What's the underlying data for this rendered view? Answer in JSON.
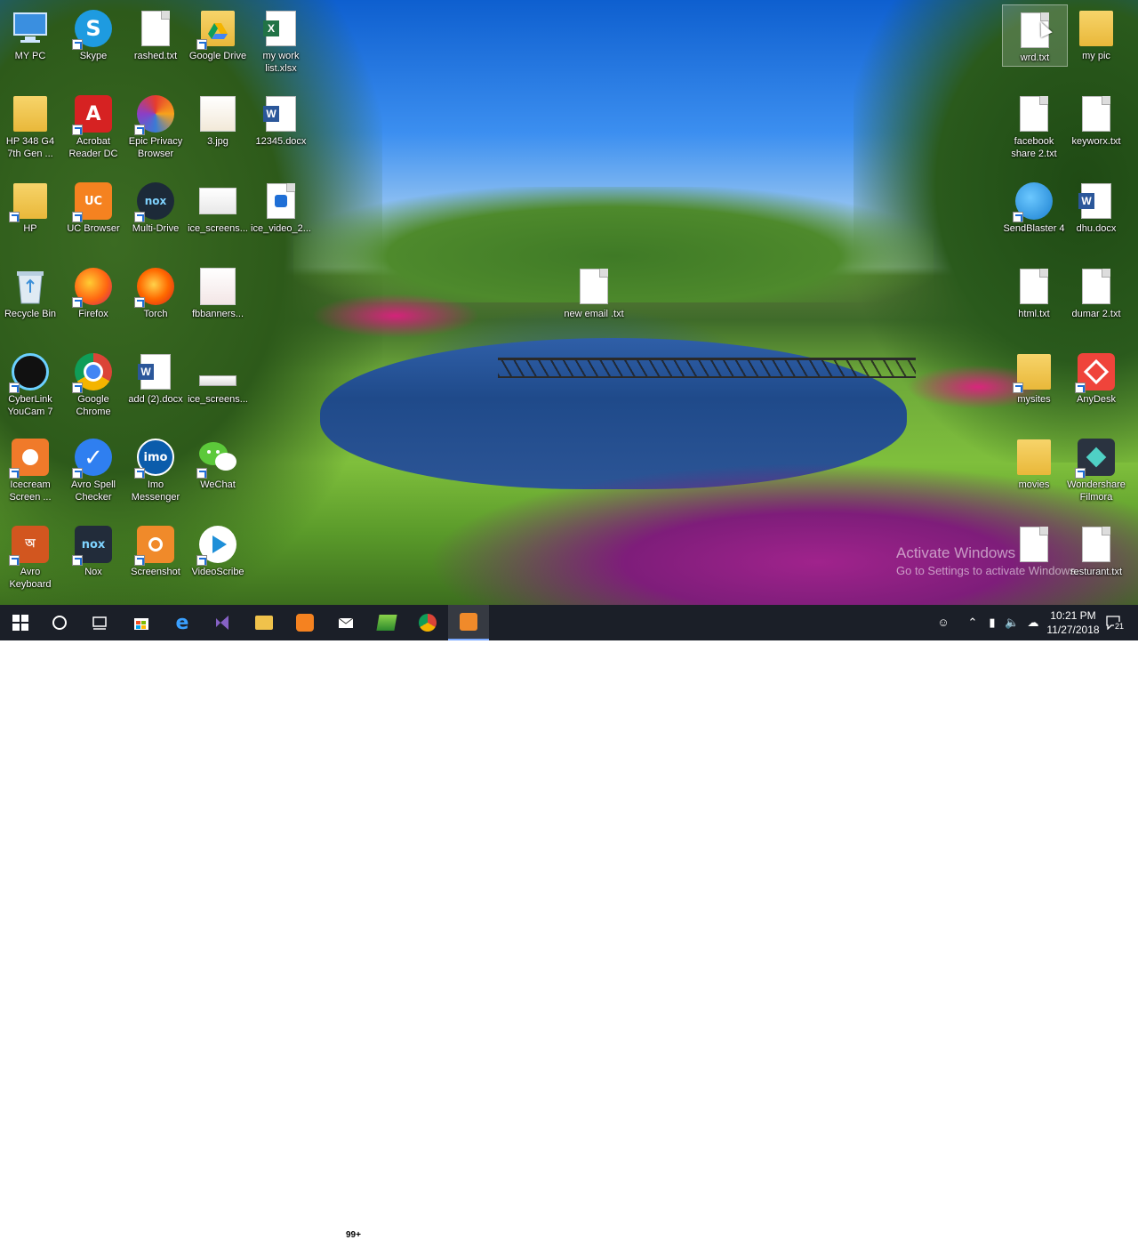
{
  "desktop": {
    "icons": [
      {
        "label": "MY PC"
      },
      {
        "label": "Skype"
      },
      {
        "label": "rashed.txt"
      },
      {
        "label": "Google Drive"
      },
      {
        "label": "my work list.xlsx"
      },
      {
        "label": "HP 348 G4 7th Gen ..."
      },
      {
        "label": "Acrobat Reader DC"
      },
      {
        "label": "Epic Privacy Browser"
      },
      {
        "label": "3.jpg"
      },
      {
        "label": "12345.docx"
      },
      {
        "label": "HP"
      },
      {
        "label": "UC Browser"
      },
      {
        "label": "Multi-Drive"
      },
      {
        "label": "ice_screens..."
      },
      {
        "label": "ice_video_2..."
      },
      {
        "label": "Recycle Bin"
      },
      {
        "label": "Firefox"
      },
      {
        "label": "Torch"
      },
      {
        "label": "fbbanners..."
      },
      {
        "label": "CyberLink YouCam 7"
      },
      {
        "label": "Google Chrome"
      },
      {
        "label": "add (2).docx"
      },
      {
        "label": "ice_screens..."
      },
      {
        "label": "Icecream Screen ..."
      },
      {
        "label": "Avro Spell Checker"
      },
      {
        "label": "Imo Messenger"
      },
      {
        "label": "WeChat"
      },
      {
        "label": "Avro Keyboard"
      },
      {
        "label": "Nox"
      },
      {
        "label": "Screenshot"
      },
      {
        "label": "VideoScribe"
      },
      {
        "label": "new email .txt"
      },
      {
        "label": "wrd.txt"
      },
      {
        "label": "my pic"
      },
      {
        "label": "facebook share 2.txt"
      },
      {
        "label": "keyworx.txt"
      },
      {
        "label": "SendBlaster 4"
      },
      {
        "label": "dhu.docx"
      },
      {
        "label": "html.txt"
      },
      {
        "label": "dumar 2.txt"
      },
      {
        "label": "mysites"
      },
      {
        "label": "AnyDesk"
      },
      {
        "label": "movies"
      },
      {
        "label": "Wondershare Filmora"
      },
      {
        "label": ""
      },
      {
        "label": "resturant.txt"
      }
    ],
    "icon_glyphs": {
      "skype": "S",
      "acrobat": "A",
      "uc": "UC",
      "multi_drive": "nox",
      "imo": "imo",
      "avro": "অ",
      "nox": "nox"
    },
    "watermark": {
      "title": "Activate Windows",
      "subtitle": "Go to Settings to activate Windows."
    }
  },
  "taskbar": {
    "mail_badge": "99+",
    "clock": {
      "time": "10:21 PM",
      "date": "11/27/2018"
    },
    "notification_count": "21"
  },
  "colors": {
    "taskbar": "#1b1f28",
    "accent": "#1f6fd6"
  }
}
